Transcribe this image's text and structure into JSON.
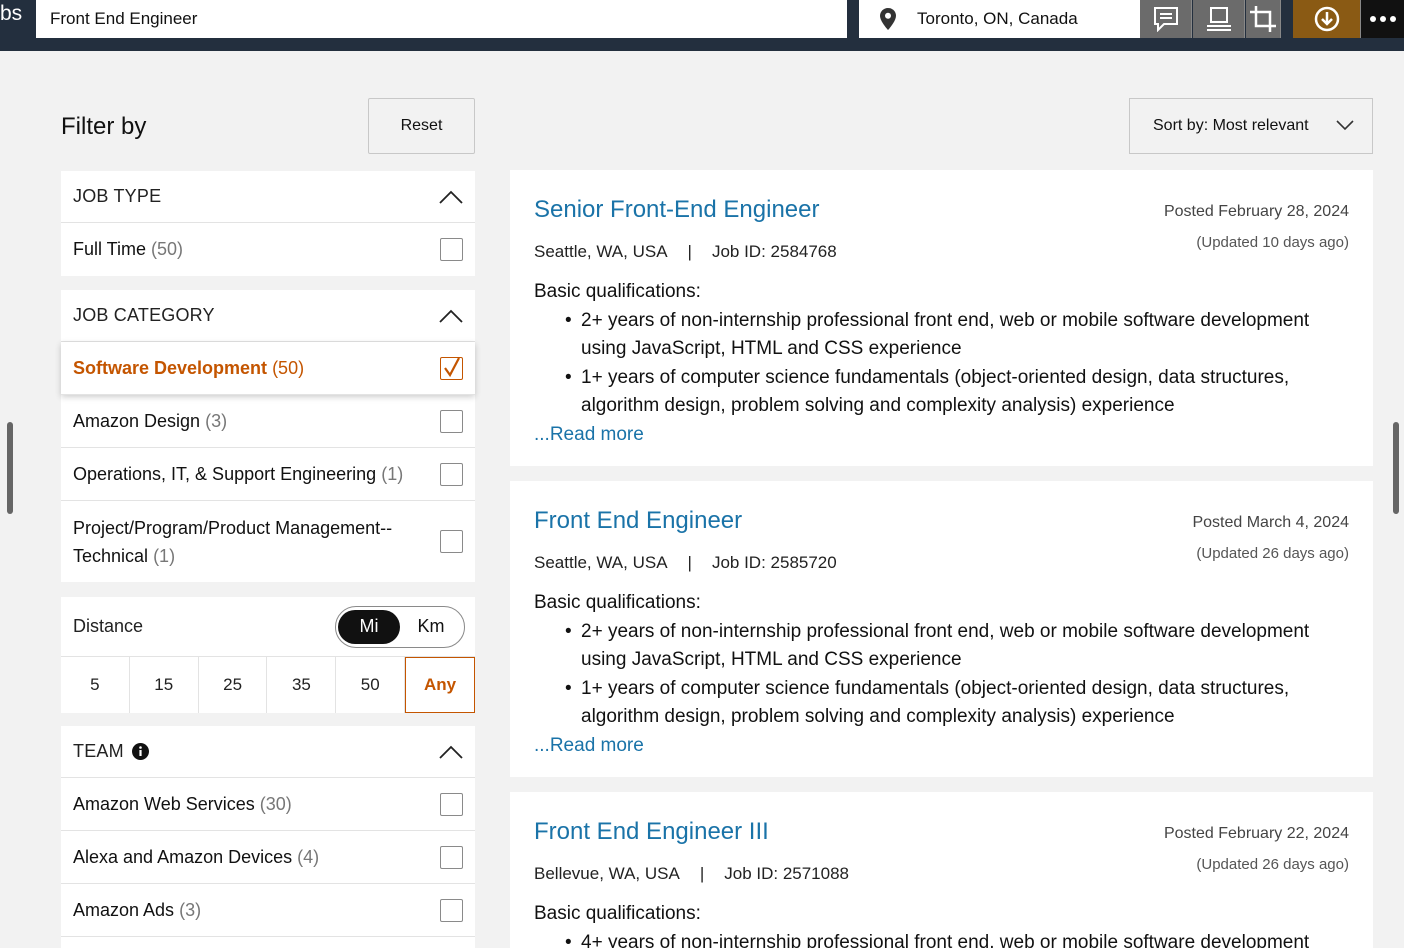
{
  "topbar": {
    "brand": "bs",
    "search_value": "Front End Engineer",
    "location_value": "Toronto, ON, Canada"
  },
  "filters": {
    "title": "Filter by",
    "reset_label": "Reset",
    "job_type": {
      "heading": "JOB TYPE",
      "options": [
        {
          "label": "Full Time",
          "count": "(50)",
          "checked": false
        }
      ]
    },
    "job_category": {
      "heading": "JOB CATEGORY",
      "options": [
        {
          "label": "Software Development",
          "count": "(50)",
          "checked": true
        },
        {
          "label": "Amazon Design",
          "count": "(3)",
          "checked": false
        },
        {
          "label": "Operations, IT, & Support Engineering",
          "count": "(1)",
          "checked": false
        },
        {
          "label": "Project/Program/Product Management--",
          "label2": "Technical",
          "count": "(1)",
          "checked": false
        }
      ]
    },
    "distance": {
      "heading": "Distance",
      "units": [
        "Mi",
        "Km"
      ],
      "selected_unit": "Mi",
      "values": [
        "5",
        "15",
        "25",
        "35",
        "50",
        "Any"
      ],
      "selected_value": "Any"
    },
    "team": {
      "heading": "TEAM",
      "options": [
        {
          "label": "Amazon Web Services",
          "count": "(30)",
          "checked": false
        },
        {
          "label": "Alexa and Amazon Devices",
          "count": "(4)",
          "checked": false
        },
        {
          "label": "Amazon Ads",
          "count": "(3)",
          "checked": false
        }
      ]
    }
  },
  "sort": {
    "label": "Sort by: Most relevant"
  },
  "jobs": [
    {
      "title": "Senior Front-End Engineer",
      "posted": "Posted February 28, 2024",
      "updated": "(Updated 10 days ago)",
      "location": "Seattle, WA, USA",
      "separator": "|",
      "job_id": "Job ID: 2584768",
      "quals_heading": "Basic qualifications:",
      "quals": [
        "2+ years of non-internship professional front end, web or mobile software development using JavaScript, HTML and CSS experience",
        "1+ years of computer science fundamentals (object-oriented design, data structures, algorithm design, problem solving and complexity analysis) experience"
      ],
      "read_more": "...Read more"
    },
    {
      "title": "Front End Engineer",
      "posted": "Posted March 4, 2024",
      "updated": "(Updated 26 days ago)",
      "location": "Seattle, WA, USA",
      "separator": "|",
      "job_id": "Job ID: 2585720",
      "quals_heading": "Basic qualifications:",
      "quals": [
        "2+ years of non-internship professional front end, web or mobile software development using JavaScript, HTML and CSS experience",
        "1+ years of computer science fundamentals (object-oriented design, data structures, algorithm design, problem solving and complexity analysis) experience"
      ],
      "read_more": "...Read more"
    },
    {
      "title": "Front End Engineer III",
      "posted": "Posted February 22, 2024",
      "updated": "(Updated 26 days ago)",
      "location": "Bellevue, WA, USA",
      "separator": "|",
      "job_id": "Job ID: 2571088",
      "quals_heading": "Basic qualifications:",
      "quals": [
        "4+ years of non-internship professional front end, web or mobile software development"
      ]
    }
  ],
  "colors": {
    "accent": "#c45500",
    "link": "#1a73a8",
    "header": "#232f3e"
  }
}
